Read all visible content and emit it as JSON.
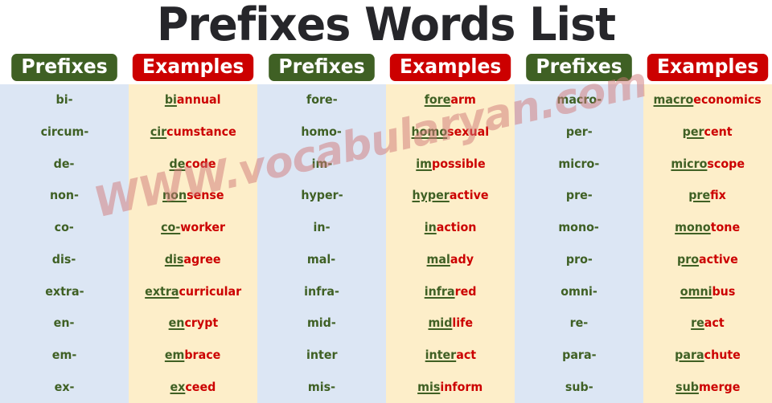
{
  "page": {
    "title": "Prefixes Words List",
    "watermark": "WWW.vocabularyan.com",
    "colors": {
      "title": "#26262a",
      "header_green": "#3f6024",
      "header_red": "#cc0000",
      "column_blue": "#dce6f4",
      "column_cream": "#fdeec9",
      "prefix_text": "#3f6024",
      "example_rest": "#cc0000",
      "watermark": "#d07878"
    }
  },
  "headers": [
    {
      "label": "Prefixes",
      "style": "green"
    },
    {
      "label": "Examples",
      "style": "red"
    },
    {
      "label": "Prefixes",
      "style": "green"
    },
    {
      "label": "Examples",
      "style": "red"
    },
    {
      "label": "Prefixes",
      "style": "green"
    },
    {
      "label": "Examples",
      "style": "red"
    }
  ],
  "groups": [
    {
      "prefixes": [
        "bi-",
        "circum-",
        "de-",
        "non-",
        "co-",
        "dis-",
        "extra-",
        "en-",
        "em-",
        "ex-"
      ],
      "examples": [
        {
          "prefix": "bi",
          "rest": "annual"
        },
        {
          "prefix": "cir",
          "rest": "cumstance"
        },
        {
          "prefix": "de",
          "rest": "code"
        },
        {
          "prefix": "non",
          "rest": "sense"
        },
        {
          "prefix": "co-",
          "rest": "worker"
        },
        {
          "prefix": "dis",
          "rest": "agree"
        },
        {
          "prefix": "extra",
          "rest": "curricular"
        },
        {
          "prefix": "en",
          "rest": "crypt"
        },
        {
          "prefix": "em",
          "rest": "brace"
        },
        {
          "prefix": "ex",
          "rest": "ceed"
        }
      ]
    },
    {
      "prefixes": [
        "fore-",
        "homo-",
        "im-",
        "hyper-",
        "in-",
        "mal-",
        "infra-",
        "mid-",
        "inter",
        "mis-"
      ],
      "examples": [
        {
          "prefix": "fore",
          "rest": "arm"
        },
        {
          "prefix": "homo",
          "rest": "sexual"
        },
        {
          "prefix": "im",
          "rest": "possible"
        },
        {
          "prefix": "hyper",
          "rest": "active"
        },
        {
          "prefix": "in",
          "rest": "action"
        },
        {
          "prefix": "mal",
          "rest": "ady"
        },
        {
          "prefix": "infra",
          "rest": "red"
        },
        {
          "prefix": "mid",
          "rest": "life"
        },
        {
          "prefix": "inter",
          "rest": "act"
        },
        {
          "prefix": "mis",
          "rest": "inform"
        }
      ]
    },
    {
      "prefixes": [
        "macro-",
        "per-",
        "micro-",
        "pre-",
        "mono-",
        "pro-",
        "omni-",
        "re-",
        "para-",
        "sub-"
      ],
      "examples": [
        {
          "prefix": "macro",
          "rest": "economics"
        },
        {
          "prefix": "per",
          "rest": "cent"
        },
        {
          "prefix": "micro",
          "rest": "scope"
        },
        {
          "prefix": "pre",
          "rest": "fix"
        },
        {
          "prefix": "mono",
          "rest": "tone"
        },
        {
          "prefix": "pro",
          "rest": "active"
        },
        {
          "prefix": "omni",
          "rest": "bus"
        },
        {
          "prefix": "re",
          "rest": "act"
        },
        {
          "prefix": "para",
          "rest": "chute"
        },
        {
          "prefix": "sub",
          "rest": "merge"
        }
      ]
    }
  ]
}
